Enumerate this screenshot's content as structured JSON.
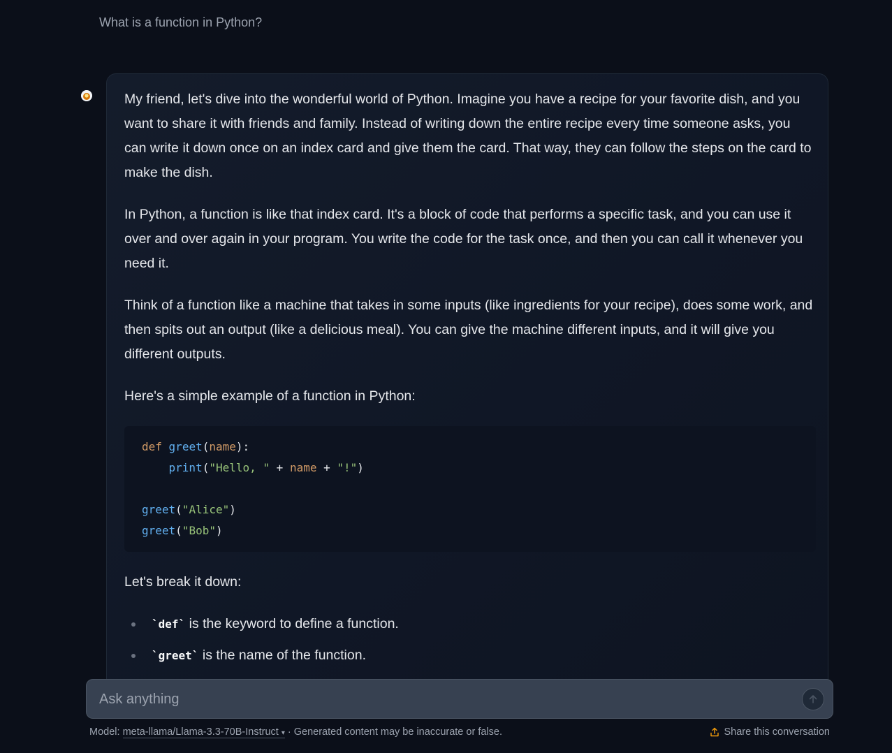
{
  "user_message": "What is a function in Python?",
  "response": {
    "paragraphs": [
      "My friend, let's dive into the wonderful world of Python. Imagine you have a recipe for your favorite dish, and you want to share it with friends and family. Instead of writing down the entire recipe every time someone asks, you can write it down once on an index card and give them the card. That way, they can follow the steps on the card to make the dish.",
      "In Python, a function is like that index card. It's a block of code that performs a specific task, and you can use it over and over again in your program. You write the code for the task once, and then you can call it whenever you need it.",
      "Think of a function like a machine that takes in some inputs (like ingredients for your recipe), does some work, and then spits out an output (like a delicious meal). You can give the machine different inputs, and it will give you different outputs.",
      "Here's a simple example of a function in Python:"
    ],
    "code": {
      "line1": {
        "kw": "def",
        "fn": "greet",
        "open": "(",
        "param": "name",
        "close": "):"
      },
      "line2": {
        "indent": "    ",
        "fn": "print",
        "open": "(",
        "str1": "\"Hello, \"",
        "op1": " + ",
        "var": "name",
        "op2": " + ",
        "str2": "\"!\"",
        "close": ")"
      },
      "line4": {
        "fn": "greet",
        "open": "(",
        "str": "\"Alice\"",
        "close": ")"
      },
      "line5": {
        "fn": "greet",
        "open": "(",
        "str": "\"Bob\"",
        "close": ")"
      }
    },
    "breakdown_intro": "Let's break it down:",
    "bullets": [
      {
        "code": "`def`",
        "text": " is the keyword to define a function."
      },
      {
        "code": "`greet`",
        "text": " is the name of the function."
      }
    ]
  },
  "input": {
    "placeholder": "Ask anything"
  },
  "footer": {
    "model_prefix": "Model: ",
    "model_name": "meta-llama/Llama-3.3-70B-Instruct",
    "disclaimer": " · Generated content may be inaccurate or false.",
    "share_label": "Share this conversation"
  },
  "colors": {
    "background": "#0b0f19",
    "accent_share": "#f59e0b",
    "code_keyword": "#d19a66",
    "code_function": "#61afef",
    "code_string": "#98c379"
  },
  "icons": {
    "avatar": "assistant-avatar-icon",
    "send": "arrow-up-icon",
    "share": "upload-icon",
    "dropdown": "caret-down-icon"
  }
}
